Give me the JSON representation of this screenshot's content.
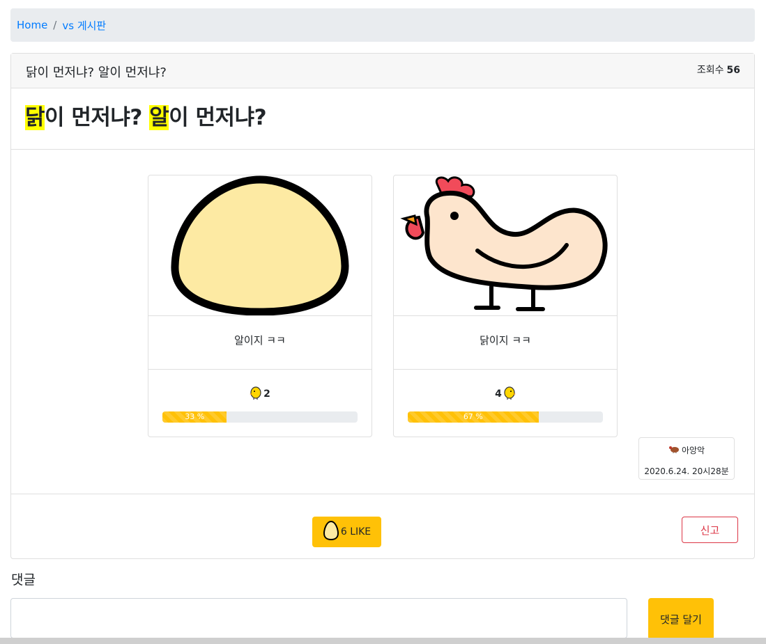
{
  "breadcrumb": {
    "home": "Home",
    "separator": "/",
    "board": "vs 게시판"
  },
  "post": {
    "header_title": "닭이 먼저냐? 알이 먼저냐?",
    "views_label": "조회수",
    "views_count": "56",
    "title_part1": "닭",
    "title_part2": "이 먼저냐? ",
    "title_part3": "알",
    "title_part4": "이 먼저냐?"
  },
  "choices": [
    {
      "image": "egg-image",
      "label": "알이지 ㅋㅋ",
      "count": "2",
      "percent": 33,
      "percent_label": "33 %"
    },
    {
      "image": "chicken-image",
      "label": "닭이지 ㅋㅋ",
      "count": "4",
      "percent": 67,
      "percent_label": "67 %"
    }
  ],
  "author": {
    "icon": "turkey-icon",
    "name": "아앙악",
    "date": "2020.6.24. 20시28분"
  },
  "like_button": {
    "icon": "egg-icon",
    "label": "6 LIKE"
  },
  "report_button": {
    "label": "신고"
  },
  "comments": {
    "heading": "댓글",
    "input_value": "",
    "submit_label": "댓글 달기"
  },
  "colors": {
    "accent": "#ffc107",
    "danger": "#dc3545",
    "link": "#007bff",
    "highlight": "#ffff00"
  }
}
